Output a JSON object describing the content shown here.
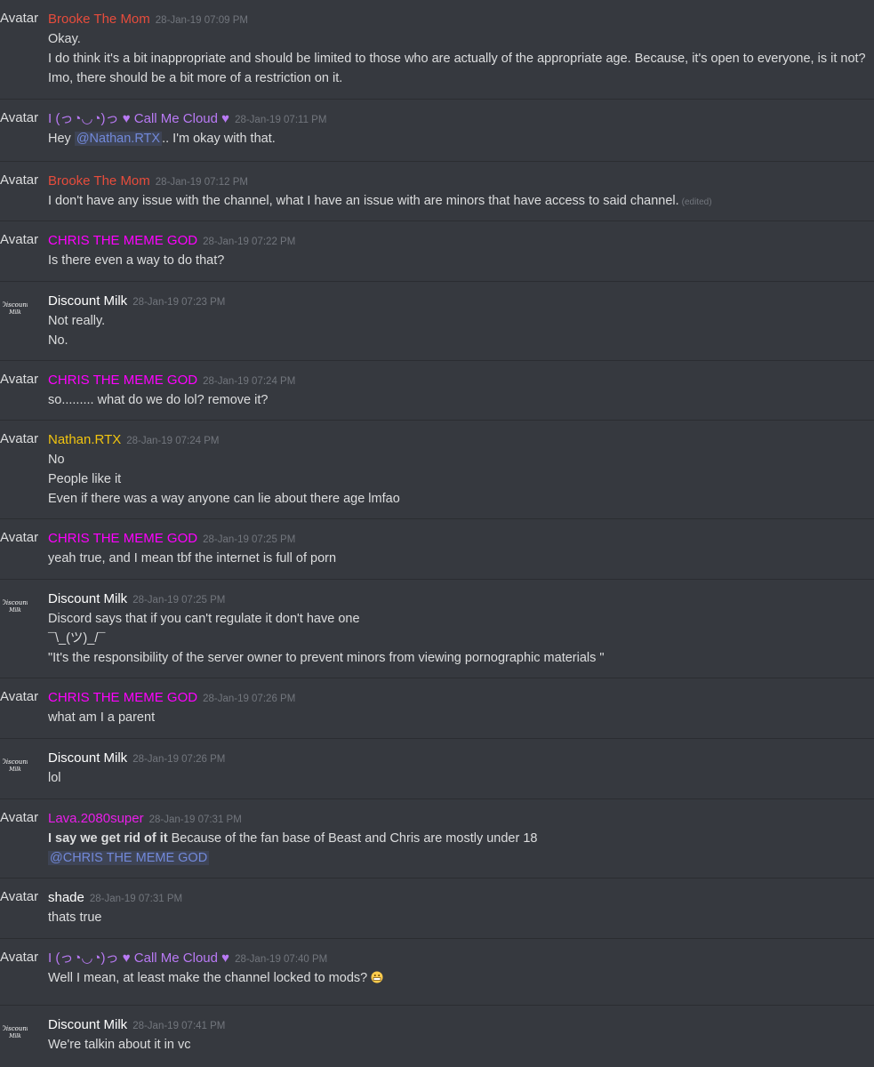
{
  "avatar_placeholder": "Avatar",
  "colors": {
    "background": "#36393f",
    "text": "#dcddde",
    "timestamp": "#72767d",
    "mention": "#7289da",
    "brooke": "#e74c3c",
    "cloud": "#b97af5",
    "chris": "#ff00ff",
    "milk": "#ffffff",
    "nathan": "#f1c40f",
    "lava": "#e91ee9",
    "shade": "#ffffff"
  },
  "messages": [
    {
      "author": "Brooke The Mom",
      "color": "brooke",
      "avatar": "text",
      "time": "28-Jan-19 07:09 PM",
      "lines": [
        "Okay.",
        "I do think it's a bit inappropriate and should be limited to those who are actually of the appropriate age. Because, it's open to everyone, is it not?",
        "Imo, there should be a bit more of a restriction on it."
      ]
    },
    {
      "author": "I (っ◔◡◔)っ ♥ Call Me Cloud ♥",
      "color": "cloud",
      "avatar": "text",
      "time": "28-Jan-19 07:11 PM",
      "lines": [
        "Hey |@Nathan.RTX|.. I'm okay with that."
      ]
    },
    {
      "author": "Brooke The Mom",
      "color": "brooke",
      "avatar": "text",
      "time": "28-Jan-19 07:12 PM",
      "lines": [
        "I don't have any issue with the channel, what I have an issue with are minors that have access to said channel."
      ],
      "edited": "(edited)"
    },
    {
      "author": "CHRIS THE MEME GOD",
      "color": "chris",
      "avatar": "text",
      "time": "28-Jan-19 07:22 PM",
      "lines": [
        "Is there even a way to do that?"
      ]
    },
    {
      "author": "Discount Milk",
      "color": "milk",
      "avatar": "image",
      "avatar_alt": "Discount Milk",
      "time": "28-Jan-19 07:23 PM",
      "lines": [
        "Not really.",
        "No."
      ]
    },
    {
      "author": "CHRIS THE MEME GOD",
      "color": "chris",
      "avatar": "text",
      "time": "28-Jan-19 07:24 PM",
      "lines": [
        "so......... what do we do lol? remove it?"
      ]
    },
    {
      "author": "Nathan.RTX",
      "color": "nathan",
      "avatar": "text",
      "time": "28-Jan-19 07:24 PM",
      "lines": [
        "No",
        "People like it",
        "Even if there was a way anyone can lie about there age lmfao"
      ]
    },
    {
      "author": "CHRIS THE MEME GOD",
      "color": "chris",
      "avatar": "text",
      "time": "28-Jan-19 07:25 PM",
      "lines": [
        "yeah true, and I mean tbf the internet is full of porn"
      ]
    },
    {
      "author": "Discount Milk",
      "color": "milk",
      "avatar": "image",
      "avatar_alt": "Discount Milk",
      "time": "28-Jan-19 07:25 PM",
      "lines": [
        "Discord says that if  you can't regulate it don't have one",
        "¯\\_(ツ)_/¯",
        "\"It's the responsibility of the server owner to prevent minors from viewing pornographic materials \""
      ]
    },
    {
      "author": "CHRIS THE MEME GOD",
      "color": "chris",
      "avatar": "text",
      "time": "28-Jan-19 07:26 PM",
      "lines": [
        "what am I a parent"
      ]
    },
    {
      "author": "Discount Milk",
      "color": "milk",
      "avatar": "image",
      "avatar_alt": "Discount Milk",
      "time": "28-Jan-19 07:26 PM",
      "lines": [
        "lol"
      ]
    },
    {
      "author": "Lava.2080super",
      "color": "lava",
      "avatar": "text",
      "time": "28-Jan-19 07:31 PM",
      "lines": [
        "*I say we get rid of it* Because of the fan base of Beast and Chris are mostly under 18",
        "|@CHRIS THE MEME GOD|"
      ]
    },
    {
      "author": "shade",
      "color": "shade",
      "avatar": "text",
      "time": "28-Jan-19 07:31 PM",
      "lines": [
        "thats true"
      ]
    },
    {
      "author": "I (っ◔◡◔)っ ♥ Call Me Cloud ♥",
      "color": "cloud",
      "avatar": "text",
      "time": "28-Jan-19 07:40 PM",
      "lines": [
        "Well I mean, at least make the channel locked to mods?"
      ],
      "emoji": "grimacing-emoji"
    },
    {
      "author": "Discount Milk",
      "color": "milk",
      "avatar": "image",
      "avatar_alt": "Discount Milk",
      "time": "28-Jan-19 07:41 PM",
      "lines": [
        "We're talkin about it in vc"
      ]
    }
  ]
}
